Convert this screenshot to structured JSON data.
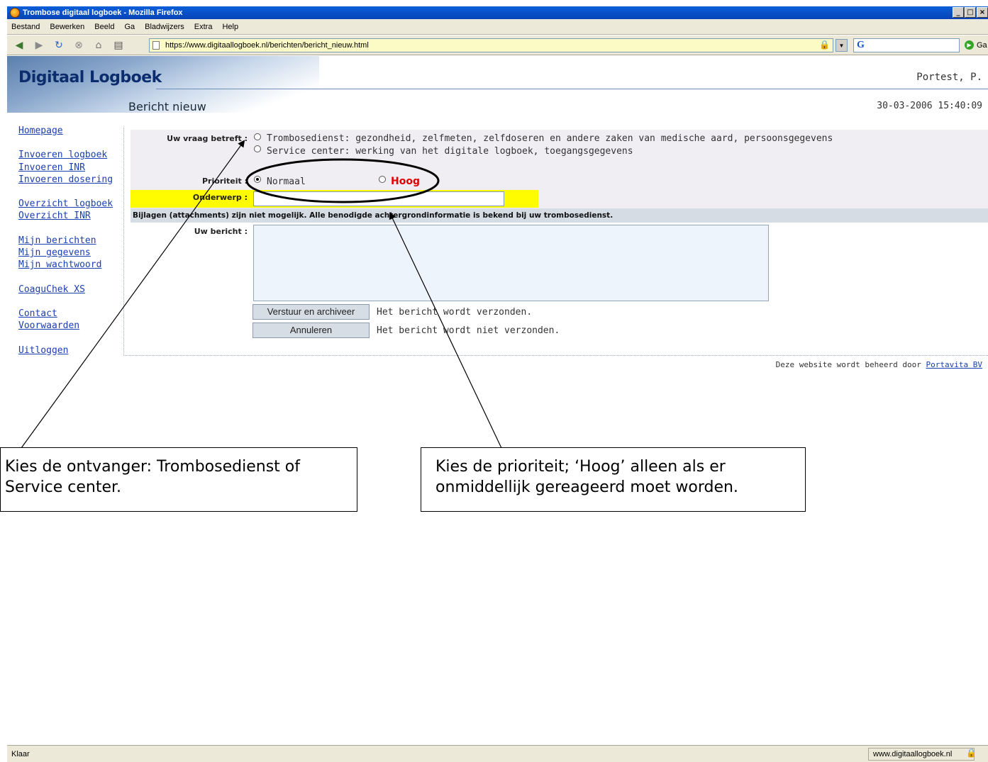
{
  "window": {
    "title": "Trombose digitaal logboek - Mozilla Firefox"
  },
  "menu": [
    "Bestand",
    "Bewerken",
    "Beeld",
    "Ga",
    "Bladwijzers",
    "Extra",
    "Help"
  ],
  "browser": {
    "url": "https://www.digitaallogboek.nl/berichten/bericht_nieuw.html",
    "search_placeholder": "G",
    "go_label": "Ga"
  },
  "header": {
    "logo": "Digitaal Logboek",
    "user": "Portest, P.",
    "page_title": "Bericht nieuw",
    "datetime": "30-03-2006 15:40:09"
  },
  "sidebar": {
    "items": [
      "Homepage",
      "Invoeren logboek",
      "Invoeren INR",
      "Invoeren dosering",
      "Overzicht logboek",
      "Overzicht INR",
      "Mijn berichten",
      "Mijn gegevens",
      "Mijn wachtwoord",
      "CoaguChek XS",
      "Contact",
      "Voorwaarden",
      "Uitloggen"
    ]
  },
  "form": {
    "vraag_label": "Uw vraag betreft :",
    "vraag_options": [
      "Trombosedienst: gezondheid, zelfmeten, zelfdoseren en andere zaken van medische aard, persoonsgegevens",
      "Service center: werking van het digitale logboek, toegangsgegevens"
    ],
    "prioriteit_label": "Prioriteit :",
    "prioriteit_normaal": "Normaal",
    "prioriteit_hoog": "Hoog",
    "onderwerp_label": "Onderwerp :",
    "onderwerp_value": "",
    "attachments_note": "Bijlagen (attachments) zijn niet mogelijk. Alle benodigde achtergrondinformatie is bekend bij uw trombosedienst.",
    "bericht_label": "Uw bericht :",
    "bericht_value": "",
    "send_button": "Verstuur en archiveer",
    "send_note": "Het bericht wordt verzonden.",
    "cancel_button": "Annuleren",
    "cancel_note": "Het bericht wordt niet verzonden."
  },
  "footer": {
    "text": "Deze website wordt beheerd door",
    "link": "Portavita BV"
  },
  "callouts": {
    "left": "Kies de ontvanger: Trombosedienst of Service center.",
    "right": "Kies de prioriteit; ‘Hoog’ alleen als er onmiddellijk gereageerd moet worden."
  },
  "status": {
    "text": "Klaar",
    "domain": "www.digitaallogboek.nl"
  }
}
